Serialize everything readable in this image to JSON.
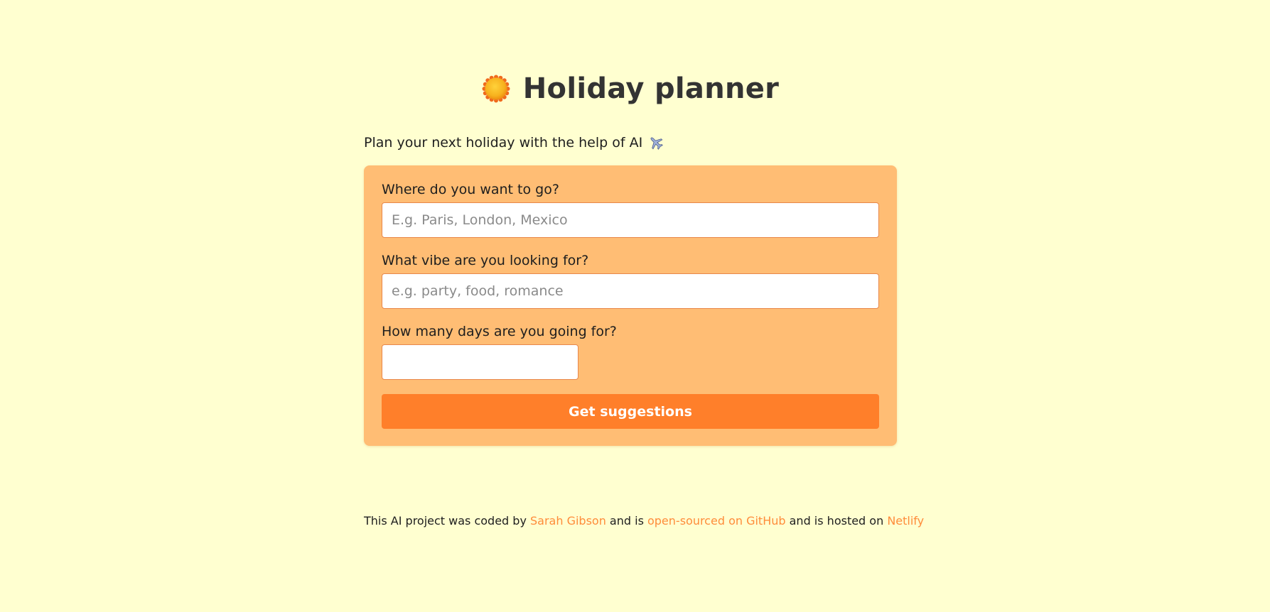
{
  "header": {
    "title": "Holiday planner",
    "icon": "sun-icon"
  },
  "subtitle": {
    "text": "Plan your next holiday with the help of AI",
    "icon": "airplane-icon"
  },
  "form": {
    "destination": {
      "label": "Where do you want to go?",
      "placeholder": "E.g. Paris, London, Mexico",
      "value": ""
    },
    "vibe": {
      "label": "What vibe are you looking for?",
      "placeholder": "e.g. party, food, romance",
      "value": ""
    },
    "days": {
      "label": "How many days are you going for?",
      "placeholder": "",
      "value": ""
    },
    "submit_label": "Get suggestions"
  },
  "footer": {
    "part1": "This AI project was coded by ",
    "author_link": "Sarah Gibson",
    "part2": " and is ",
    "github_link": "open-sourced on GitHub",
    "part3": " and is hosted on ",
    "host_link": "Netlify"
  },
  "colors": {
    "background": "#ffffd0",
    "card": "#ffbd74",
    "button": "#ff7f2a",
    "link": "#ff8c3a"
  }
}
